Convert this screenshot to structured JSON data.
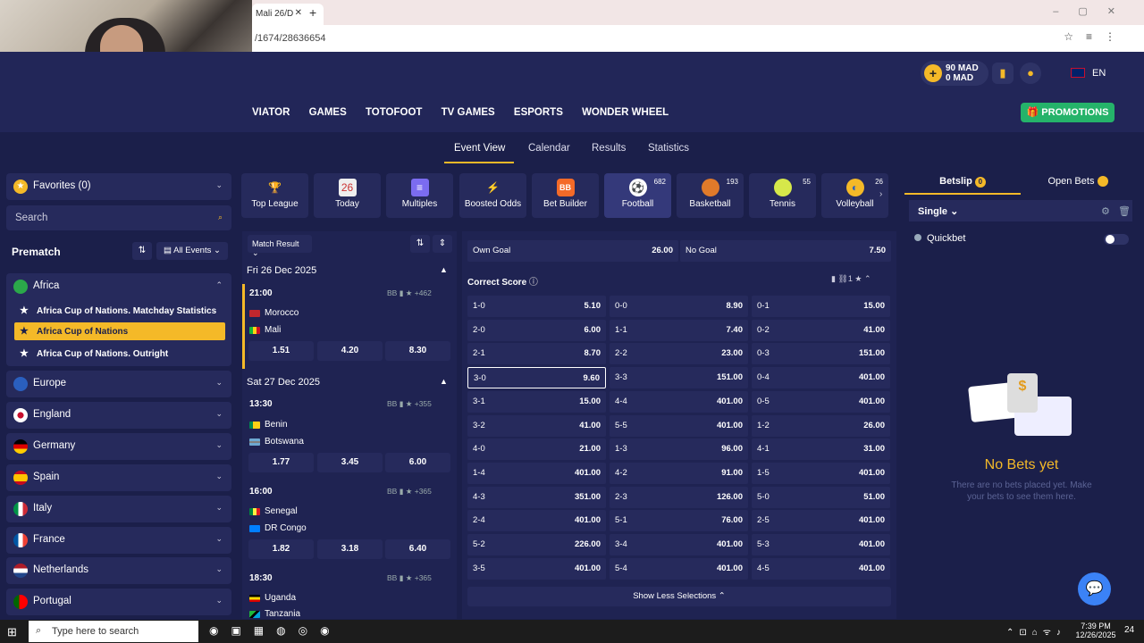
{
  "browser": {
    "tab_title": "Mali 26/D",
    "new_tab": "+",
    "url": "/1674/28636654"
  },
  "header": {
    "balance_main": "90 MAD",
    "balance_bonus": "0 MAD",
    "language": "EN",
    "nav": [
      "VIATOR",
      "GAMES",
      "TOTOFOOT",
      "TV GAMES",
      "ESPORTS",
      "WONDER WHEEL"
    ],
    "promotions_label": "PROMOTIONS"
  },
  "subnav": {
    "tabs": [
      "Event View",
      "Calendar",
      "Results",
      "Statistics"
    ]
  },
  "sidebar": {
    "favorites_label": "Favorites (0)",
    "search_placeholder": "Search",
    "prematch_label": "Prematch",
    "all_events_label": "All Events",
    "africa_label": "Africa",
    "africa_items": [
      "Africa Cup of Nations. Matchday Statistics",
      "Africa Cup of Nations",
      "Africa Cup of Nations. Outright"
    ],
    "countries": [
      "Europe",
      "England",
      "Germany",
      "Spain",
      "Italy",
      "France",
      "Netherlands",
      "Portugal"
    ]
  },
  "sports": [
    {
      "label": "Top League",
      "count": ""
    },
    {
      "label": "Today",
      "count": "",
      "day": "26"
    },
    {
      "label": "Multiples",
      "count": ""
    },
    {
      "label": "Boosted Odds",
      "count": ""
    },
    {
      "label": "Bet Builder",
      "count": "",
      "badge": "BB"
    },
    {
      "label": "Football",
      "count": "682"
    },
    {
      "label": "Basketball",
      "count": "193"
    },
    {
      "label": "Tennis",
      "count": "55"
    },
    {
      "label": "Volleyball",
      "count": "26"
    }
  ],
  "events": {
    "filter_label": "Match Result",
    "dates": [
      "Fri 26 Dec 2025",
      "Sat 27 Dec 2025"
    ],
    "matches": [
      {
        "time": "21:00",
        "more": "+462",
        "home": "Morocco",
        "away": "Mali",
        "odds": [
          "1.51",
          "4.20",
          "8.30"
        ]
      },
      {
        "time": "13:30",
        "more": "+355",
        "home": "Benin",
        "away": "Botswana",
        "odds": [
          "1.77",
          "3.45",
          "6.00"
        ]
      },
      {
        "time": "16:00",
        "more": "+365",
        "home": "Senegal",
        "away": "DR Congo",
        "odds": [
          "1.82",
          "3.18",
          "6.40"
        ]
      },
      {
        "time": "18:30",
        "more": "+365",
        "home": "Uganda",
        "away": "Tanzania",
        "odds": []
      }
    ],
    "bb": "BB"
  },
  "market": {
    "own_goal": {
      "label": "Own Goal",
      "odd": "26.00"
    },
    "no_goal": {
      "label": "No Goal",
      "odd": "7.50"
    },
    "title": "Correct Score",
    "count": "1",
    "rows": [
      [
        [
          "1-0",
          "5.10"
        ],
        [
          "0-0",
          "8.90"
        ],
        [
          "0-1",
          "15.00"
        ]
      ],
      [
        [
          "2-0",
          "6.00"
        ],
        [
          "1-1",
          "7.40"
        ],
        [
          "0-2",
          "41.00"
        ]
      ],
      [
        [
          "2-1",
          "8.70"
        ],
        [
          "2-2",
          "23.00"
        ],
        [
          "0-3",
          "151.00"
        ]
      ],
      [
        [
          "3-0",
          "9.60"
        ],
        [
          "3-3",
          "151.00"
        ],
        [
          "0-4",
          "401.00"
        ]
      ],
      [
        [
          "3-1",
          "15.00"
        ],
        [
          "4-4",
          "401.00"
        ],
        [
          "0-5",
          "401.00"
        ]
      ],
      [
        [
          "3-2",
          "41.00"
        ],
        [
          "5-5",
          "401.00"
        ],
        [
          "1-2",
          "26.00"
        ]
      ],
      [
        [
          "4-0",
          "21.00"
        ],
        [
          "1-3",
          "96.00"
        ],
        [
          "4-1",
          "31.00"
        ]
      ],
      [
        [
          "1-4",
          "401.00"
        ],
        [
          "4-2",
          "91.00"
        ],
        [
          "1-5",
          "401.00"
        ]
      ],
      [
        [
          "4-3",
          "351.00"
        ],
        [
          "2-3",
          "126.00"
        ],
        [
          "5-0",
          "51.00"
        ]
      ],
      [
        [
          "2-4",
          "401.00"
        ],
        [
          "5-1",
          "76.00"
        ],
        [
          "2-5",
          "401.00"
        ]
      ],
      [
        [
          "5-2",
          "226.00"
        ],
        [
          "3-4",
          "401.00"
        ],
        [
          "5-3",
          "401.00"
        ]
      ],
      [
        [
          "3-5",
          "401.00"
        ],
        [
          "5-4",
          "401.00"
        ],
        [
          "4-5",
          "401.00"
        ]
      ]
    ],
    "show_less": "Show Less Selections"
  },
  "betslip": {
    "tab_betslip": "Betslip",
    "tab_open": "Open Bets",
    "betslip_count": "0",
    "mode": "Single",
    "quickbet": "Quickbet",
    "empty_title": "No Bets yet",
    "empty_text": "There are no bets placed yet. Make your bets to see them here."
  },
  "taskbar": {
    "search_placeholder": "Type here to search",
    "time": "7:39 PM",
    "date": "12/26/2025",
    "notif": "24"
  },
  "colors": {
    "accent": "#f4b928",
    "bg": "#1b1f4a",
    "panel": "#262a5c",
    "green": "#25b36a"
  }
}
